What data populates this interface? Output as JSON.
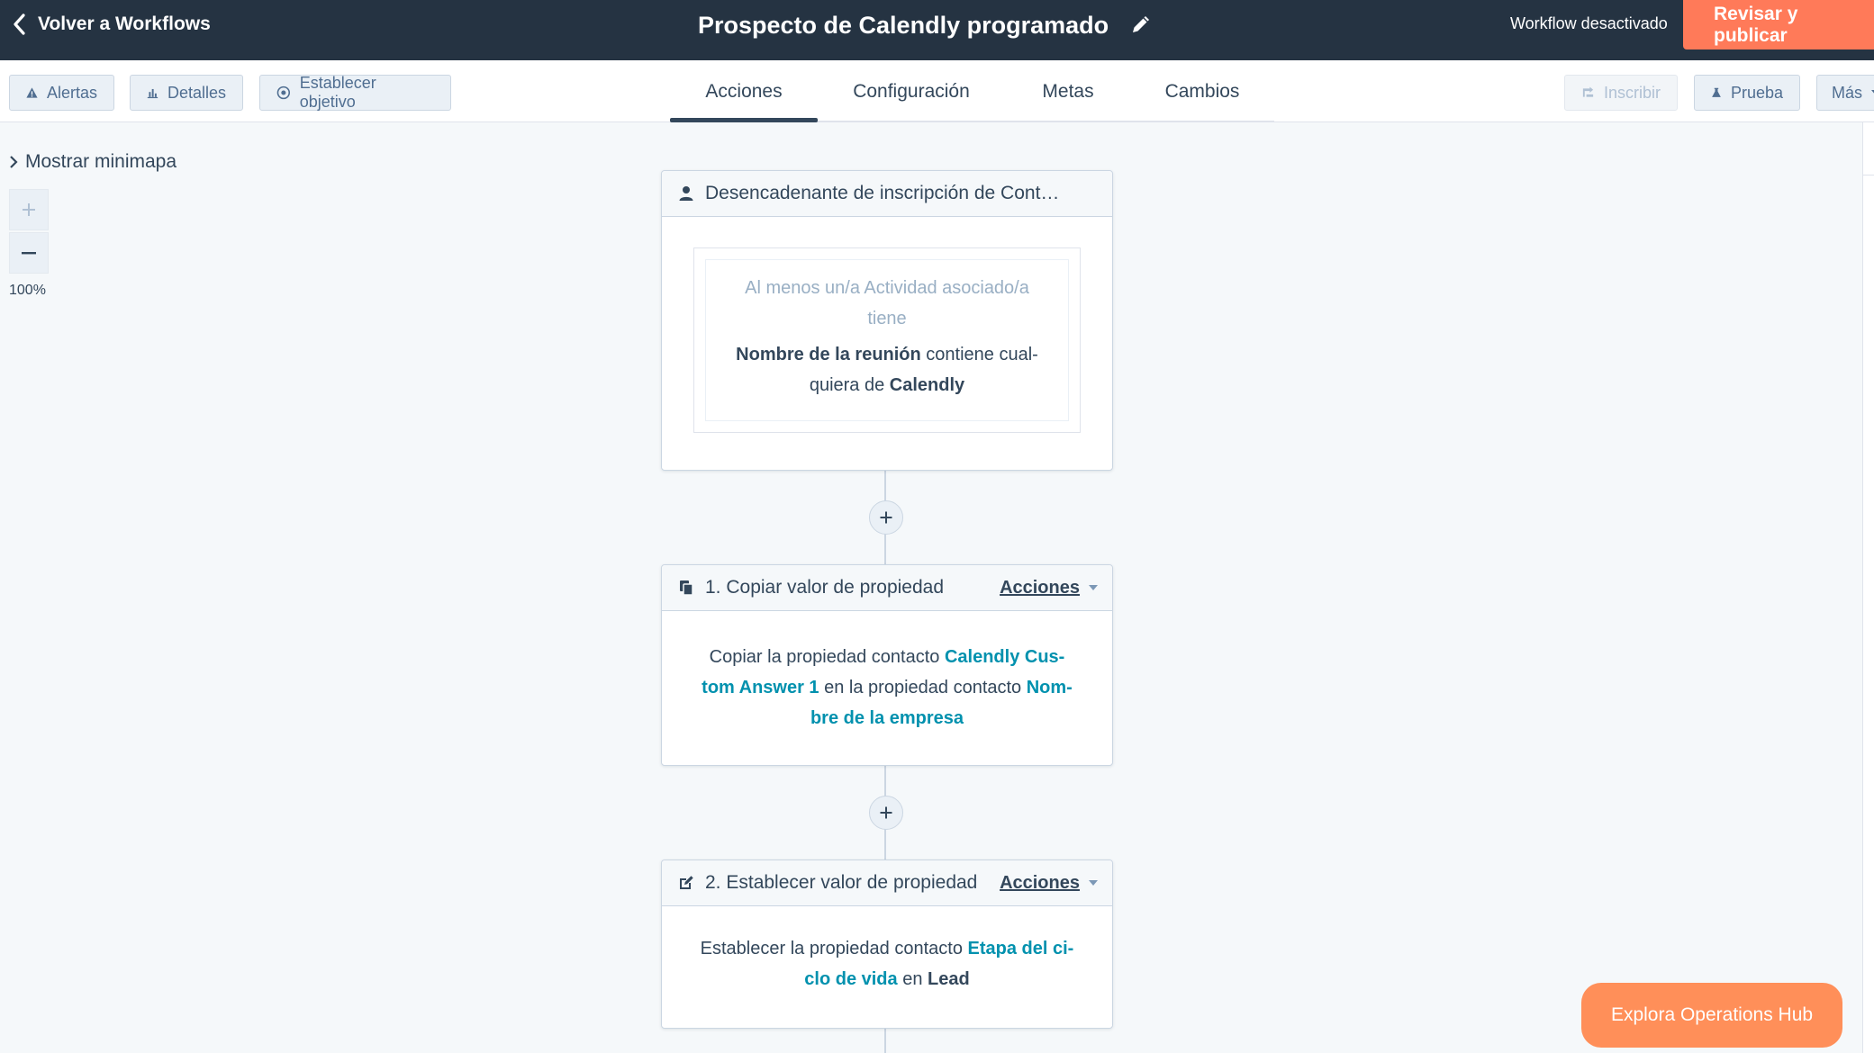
{
  "header": {
    "back_label": "Volver a Workflows",
    "title": "Prospecto de Calendly programado",
    "status": "Workflow desactivado",
    "publish_label": "Revisar y publicar"
  },
  "toolbar": {
    "left": [
      "Alertas",
      "Detalles",
      "Establecer objetivo"
    ],
    "tabs": [
      "Acciones",
      "Configuración",
      "Metas",
      "Cambios"
    ],
    "active_tab": "Acciones",
    "right": {
      "enroll": "Inscribir",
      "test": "Prueba",
      "more": "Más"
    }
  },
  "canvas": {
    "minimap_label": "Mostrar minimapa",
    "zoom_level": "100%"
  },
  "trigger": {
    "title": "Desencadenante de inscripción de Cont…",
    "line1": "Al menos un/a Actividad asociado/a",
    "line2": "tiene",
    "prop": "Nombre de la reunión",
    "op_a": " contiene cual-",
    "op_b": "quiera de ",
    "value": "Calendly"
  },
  "steps": [
    {
      "title": "1. Copiar valor de propiedad",
      "actions_label": "Acciones",
      "t1": "Copiar la propiedad contacto ",
      "p1a": "Calendly Cus-",
      "p1b": "tom Answer 1",
      "t2": " en la propiedad contacto ",
      "p2a": "Nom-",
      "p2b": "bre de la empresa"
    },
    {
      "title": "2. Establecer valor de propiedad",
      "actions_label": "Acciones",
      "t1": "Establecer la propiedad contacto ",
      "p1a": "Etapa del ci-",
      "p1b": "clo de vida",
      "t2": " en ",
      "value": "Lead"
    }
  ],
  "promo": {
    "label": "Explora Operations Hub"
  },
  "colors": {
    "topbar": "#253342",
    "accent": "#ff7a59",
    "link": "#0091ae"
  }
}
